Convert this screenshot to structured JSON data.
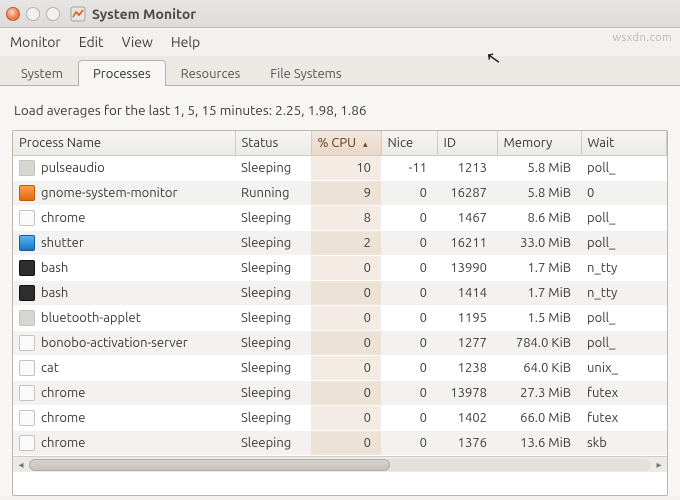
{
  "window": {
    "title": "System Monitor"
  },
  "menu": {
    "items": [
      "Monitor",
      "Edit",
      "View",
      "Help"
    ]
  },
  "tabs": {
    "items": [
      "System",
      "Processes",
      "Resources",
      "File Systems"
    ],
    "active": 1
  },
  "loadavg": {
    "label_prefix": "Load averages for the last 1, 5, 15 minutes:",
    "values": "2.25, 1.98, 1.86"
  },
  "columns": {
    "process": "Process Name",
    "status": "Status",
    "cpu": "% CPU",
    "nice": "Nice",
    "id": "ID",
    "memory": "Memory",
    "wait": "Wait"
  },
  "sort": {
    "column": "cpu",
    "direction": "asc",
    "glyph": "▴"
  },
  "processes": [
    {
      "icon": "gray",
      "name": "pulseaudio",
      "status": "Sleeping",
      "cpu": "10",
      "nice": "-11",
      "id": "1213",
      "memory": "5.8 MiB",
      "wait": "poll_"
    },
    {
      "icon": "orange",
      "name": "gnome-system-monitor",
      "status": "Running",
      "cpu": "9",
      "nice": "0",
      "id": "16287",
      "memory": "5.8 MiB",
      "wait": "0"
    },
    {
      "icon": "white",
      "name": "chrome",
      "status": "Sleeping",
      "cpu": "8",
      "nice": "0",
      "id": "1467",
      "memory": "8.6 MiB",
      "wait": "poll_"
    },
    {
      "icon": "blue",
      "name": "shutter",
      "status": "Sleeping",
      "cpu": "2",
      "nice": "0",
      "id": "16211",
      "memory": "33.0 MiB",
      "wait": "poll_"
    },
    {
      "icon": "dark",
      "name": "bash",
      "status": "Sleeping",
      "cpu": "0",
      "nice": "0",
      "id": "13990",
      "memory": "1.7 MiB",
      "wait": "n_tty"
    },
    {
      "icon": "dark",
      "name": "bash",
      "status": "Sleeping",
      "cpu": "0",
      "nice": "0",
      "id": "1414",
      "memory": "1.7 MiB",
      "wait": "n_tty"
    },
    {
      "icon": "gray",
      "name": "bluetooth-applet",
      "status": "Sleeping",
      "cpu": "0",
      "nice": "0",
      "id": "1195",
      "memory": "1.5 MiB",
      "wait": "poll_"
    },
    {
      "icon": "white",
      "name": "bonobo-activation-server",
      "status": "Sleeping",
      "cpu": "0",
      "nice": "0",
      "id": "1277",
      "memory": "784.0 KiB",
      "wait": "poll_"
    },
    {
      "icon": "white",
      "name": "cat",
      "status": "Sleeping",
      "cpu": "0",
      "nice": "0",
      "id": "1238",
      "memory": "64.0 KiB",
      "wait": "unix_"
    },
    {
      "icon": "white",
      "name": "chrome",
      "status": "Sleeping",
      "cpu": "0",
      "nice": "0",
      "id": "13978",
      "memory": "27.3 MiB",
      "wait": "futex"
    },
    {
      "icon": "white",
      "name": "chrome",
      "status": "Sleeping",
      "cpu": "0",
      "nice": "0",
      "id": "1402",
      "memory": "66.0 MiB",
      "wait": "futex"
    },
    {
      "icon": "white",
      "name": "chrome",
      "status": "Sleeping",
      "cpu": "0",
      "nice": "0",
      "id": "1376",
      "memory": "13.6 MiB",
      "wait": "skb"
    }
  ],
  "watermark": "wsxdn.com"
}
